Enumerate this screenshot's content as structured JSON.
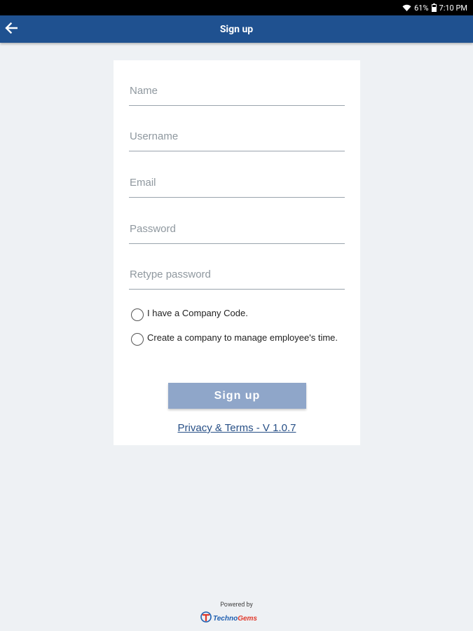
{
  "status_bar": {
    "battery": "61%",
    "time": "7:10 PM",
    "icons": [
      "wifi-icon",
      "battery-icon"
    ]
  },
  "app_bar": {
    "title": "Sign up",
    "back_icon": "arrow-left-icon",
    "color": "#1f5190"
  },
  "form": {
    "fields": [
      {
        "placeholder": "Name",
        "value": ""
      },
      {
        "placeholder": "Username",
        "value": ""
      },
      {
        "placeholder": "Email",
        "value": ""
      },
      {
        "placeholder": "Password",
        "value": ""
      },
      {
        "placeholder": "Retype password",
        "value": ""
      }
    ],
    "options": [
      {
        "label": "I have a Company Code.",
        "selected": false
      },
      {
        "label": "Create a company to manage employee's time.",
        "selected": false
      }
    ],
    "submit_label": "Sign up",
    "submit_color": "#8fa6c9",
    "privacy_link": "Privacy & Terms - V 1.0.7"
  },
  "footer": {
    "powered_by": "Powered by",
    "brand_part1": "Techno",
    "brand_part2": "Gems",
    "brand_icon": "technogems-logo-icon"
  }
}
